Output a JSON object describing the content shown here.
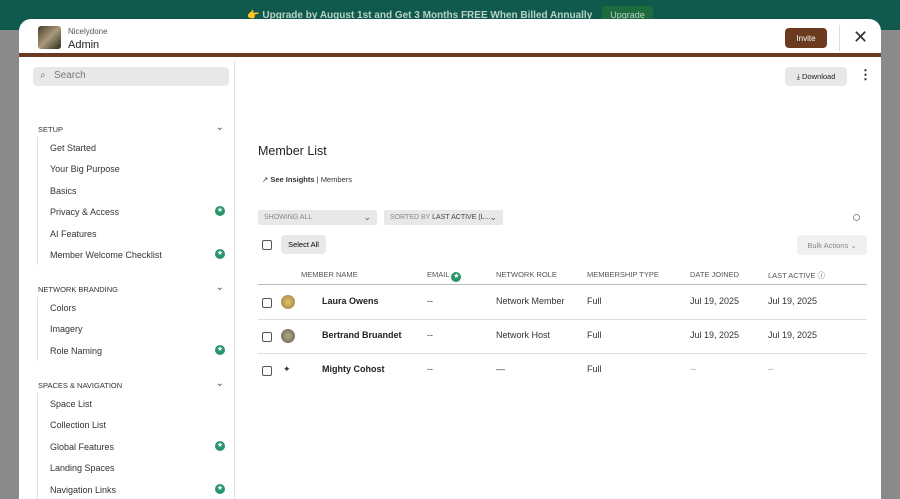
{
  "banner": {
    "text": "👉 Upgrade by August 1st and Get 3 Months FREE When Billed Annually",
    "button": "Upgrade"
  },
  "header": {
    "org": "Nicelydone",
    "title": "Admin",
    "invite": "Invite"
  },
  "sidebar": {
    "search_placeholder": "Search",
    "sections": [
      {
        "title": "SETUP",
        "items": [
          {
            "label": "Get Started"
          },
          {
            "label": "Your Big Purpose"
          },
          {
            "label": "Basics"
          },
          {
            "label": "Privacy & Access",
            "badge": true
          },
          {
            "label": "AI Features"
          },
          {
            "label": "Member Welcome Checklist",
            "badge": true
          }
        ]
      },
      {
        "title": "NETWORK BRANDING",
        "items": [
          {
            "label": "Colors"
          },
          {
            "label": "Imagery"
          },
          {
            "label": "Role Naming",
            "badge": true
          }
        ]
      },
      {
        "title": "SPACES & NAVIGATION",
        "items": [
          {
            "label": "Space List"
          },
          {
            "label": "Collection List"
          },
          {
            "label": "Global Features",
            "badge": true
          },
          {
            "label": "Landing Spaces"
          },
          {
            "label": "Navigation Links",
            "badge": true
          }
        ]
      }
    ]
  },
  "main": {
    "download": "Download",
    "title": "Member List",
    "insights": "See Insights",
    "insights_suffix": "| Members",
    "filter": "SHOWING ALL",
    "sort_prefix": "SORTED BY",
    "sort": "LAST ACTIVE (L...",
    "select_all": "Select All",
    "bulk": "Bulk Actions",
    "columns": [
      "MEMBER NAME",
      "EMAIL",
      "NETWORK ROLE",
      "MEMBERSHIP TYPE",
      "DATE JOINED",
      "LAST ACTIVE"
    ],
    "rows": [
      {
        "name": "Laura Owens",
        "email": "--",
        "role": "Network Member",
        "type": "Full",
        "joined": "Jul 19, 2025",
        "last": "Jul 19, 2025"
      },
      {
        "name": "Bertrand Bruandet",
        "email": "--",
        "role": "Network Host",
        "type": "Full",
        "joined": "Jul 19, 2025",
        "last": "Jul 19, 2025"
      },
      {
        "name": "Mighty Cohost",
        "email": "--",
        "role": "—",
        "type": "Full",
        "joined": "--",
        "last": "--"
      }
    ]
  },
  "colors": {
    "brand": "#6b3a1f",
    "badge": "#27946a"
  }
}
